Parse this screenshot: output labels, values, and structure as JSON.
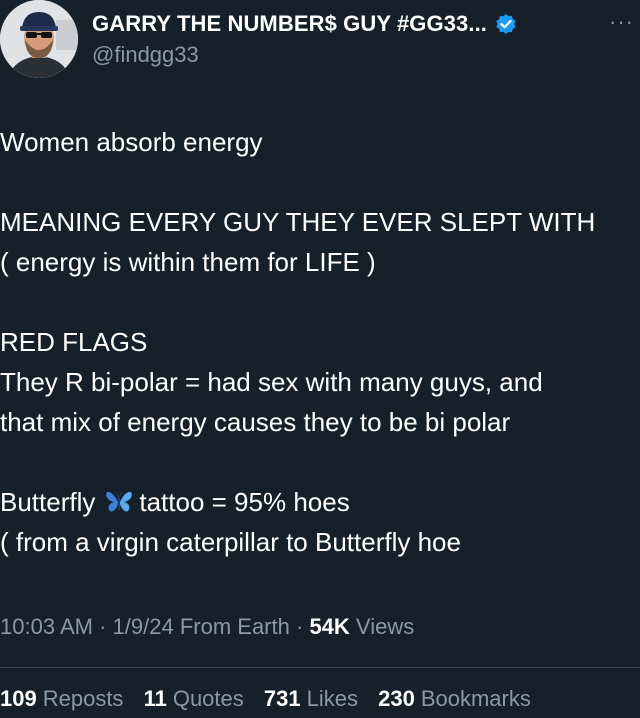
{
  "author": {
    "display_name": "GARRY THE NUMBER$ GUY #GG33...",
    "handle": "@findgg33",
    "verified": true,
    "verified_color": "#1d9bf0"
  },
  "more_label": "···",
  "tweet": {
    "lines": [
      "Women absorb energy",
      "MEANING EVERY GUY THEY EVER SLEPT WITH",
      "( energy is within them for LIFE )",
      "RED FLAGS",
      "They R bi-polar = had sex with many guys, and",
      "that mix of energy causes they to be bi polar",
      "Butterfly",
      "tattoo = 95% hoes",
      "( from a virgin caterpillar to Butterfly hoe"
    ],
    "butterfly_icon": "butterfly-icon"
  },
  "meta": {
    "time": "10:03 AM",
    "sep1": "·",
    "date": "1/9/24",
    "source": "From Earth",
    "sep2": "·",
    "views_count": "54K",
    "views_label": "Views"
  },
  "stats": {
    "reposts_count": "109",
    "reposts_label": "Reposts",
    "quotes_count": "11",
    "quotes_label": "Quotes",
    "likes_count": "731",
    "likes_label": "Likes",
    "bookmarks_count": "230",
    "bookmarks_label": "Bookmarks"
  },
  "colors": {
    "background": "#15202b",
    "text": "#ffffff",
    "secondary": "#8b98a5",
    "divider": "#38444d"
  }
}
